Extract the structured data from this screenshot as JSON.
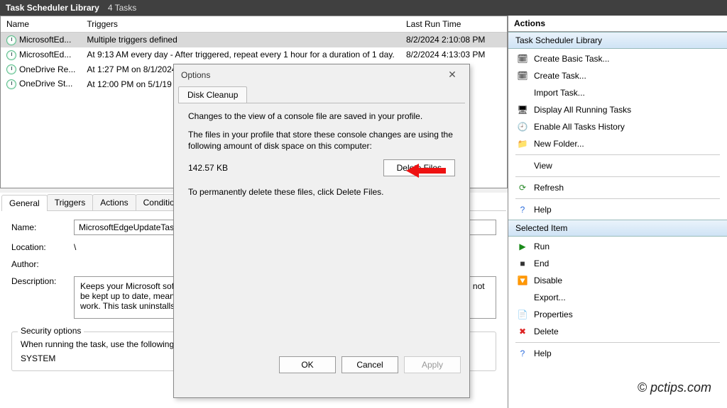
{
  "titlebar": {
    "title": "Task Scheduler Library",
    "count": "4 Tasks"
  },
  "columns": {
    "name": "Name",
    "triggers": "Triggers",
    "lastrun": "Last Run Time"
  },
  "tasks": [
    {
      "name": "MicrosoftEd...",
      "trigger": "Multiple triggers defined",
      "lastrun": "8/2/2024 2:10:08 PM"
    },
    {
      "name": "MicrosoftEd...",
      "trigger": "At 9:13 AM every day - After triggered, repeat every 1 hour for a duration of 1 day.",
      "lastrun": "8/2/2024 4:13:03 PM"
    },
    {
      "name": "OneDrive Re...",
      "trigger": "At 1:27 PM on 8/1/2024",
      "lastrun": "33 PM"
    },
    {
      "name": "OneDrive St...",
      "trigger": "At 12:00 PM on 5/1/19",
      "lastrun": ":00:00 AM"
    }
  ],
  "tabs": [
    "General",
    "Triggers",
    "Actions",
    "Conditions"
  ],
  "general": {
    "name_label": "Name:",
    "name_value": "MicrosoftEdgeUpdateTask",
    "location_label": "Location:",
    "location_value": "\\",
    "author_label": "Author:",
    "description_label": "Description:",
    "description_value": "Keeps your Microsoft software up to date. If this task is disabled or stopped, your Microsoft software will not be kept up to date, meaning security vulnerabilities that may arise cannot be fixed and features may not work. This task uninstalls itself when there is no Microsoft software using it.",
    "security_legend": "Security options",
    "security_line1": "When running the task, use the following user account:",
    "security_user": "SYSTEM"
  },
  "actions": {
    "pane_title": "Actions",
    "section1": "Task Scheduler Library",
    "items1": [
      "Create Basic Task...",
      "Create Task...",
      "Import Task...",
      "Display All Running Tasks",
      "Enable All Tasks History",
      "New Folder...",
      "View",
      "Refresh",
      "Help"
    ],
    "section2": "Selected Item",
    "items2": [
      "Run",
      "End",
      "Disable",
      "Export...",
      "Properties",
      "Delete",
      "Help"
    ]
  },
  "dialog": {
    "title": "Options",
    "tab": "Disk Cleanup",
    "p1": "Changes to the view of a console file are saved in your profile.",
    "p2": "The files in your profile that store these console changes are using the following amount of disk space on this computer:",
    "size": "142.57 KB",
    "delete_btn": "Delete Files",
    "p3": "To permanently delete these files, click Delete Files.",
    "ok": "OK",
    "cancel": "Cancel",
    "apply": "Apply"
  },
  "watermark": "© pctips.com"
}
